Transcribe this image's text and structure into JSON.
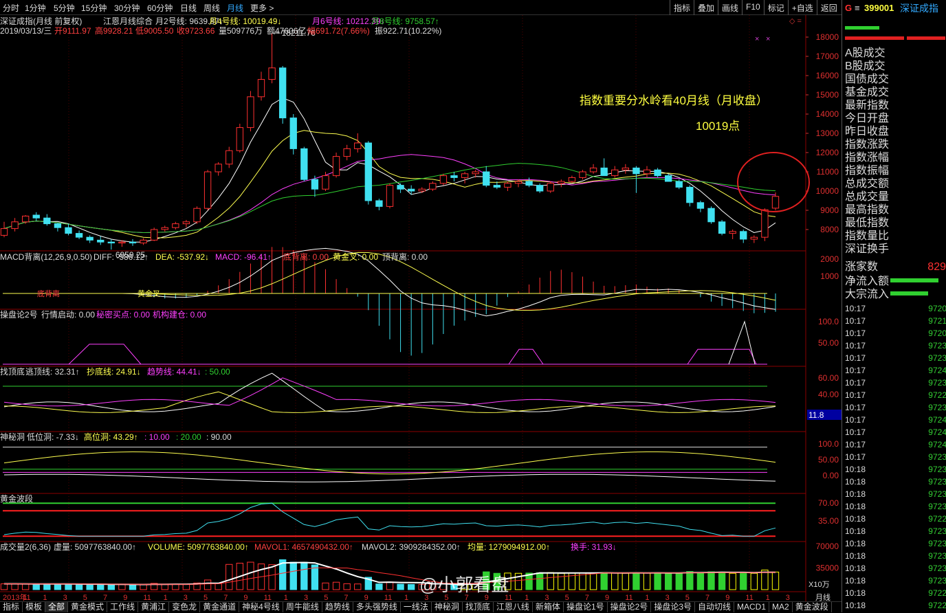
{
  "toolbar": {
    "periods": [
      {
        "label": "分时",
        "active": false
      },
      {
        "label": "1分钟",
        "active": false
      },
      {
        "label": "5分钟",
        "active": false
      },
      {
        "label": "15分钟",
        "active": false
      },
      {
        "label": "30分钟",
        "active": false
      },
      {
        "label": "60分钟",
        "active": false
      },
      {
        "label": "日线",
        "active": false
      },
      {
        "label": "周线",
        "active": false
      },
      {
        "label": "月线",
        "active": true
      },
      {
        "label": "更多 >",
        "active": false
      }
    ],
    "right_buttons": [
      "指标",
      "叠加",
      "画线",
      "F10",
      "标记",
      "+自选",
      "返回"
    ]
  },
  "main_chart": {
    "title": "深证成指(月线 前复权)",
    "indicator_name": "江恩月线综合",
    "ma2": "月2号线: 9639.87↓",
    "ma4": "月4号线: 10019.49↓",
    "ma6": "月6号线: 10212.39↓",
    "ma8": "月8号线: 9758.57↑",
    "date": "2019/03/13/三",
    "open": "开9111.97",
    "high": "高9928.21",
    "low": "低9005.50",
    "close": "收9723.66",
    "volume": "量509776万",
    "amount": "额47606亿",
    "change": "幅691.72(7.66%)",
    "amplitude": "振922.71(10.22%)",
    "high_mark": "18211.76",
    "low_mark": "6959.25",
    "annotation_line1": "指数重要分水岭看40月线（月收盘）",
    "annotation_line2": "10019点",
    "y_ticks": [
      "18000",
      "17000",
      "16000",
      "15000",
      "14000",
      "13000",
      "12000",
      "11000",
      "10000",
      "9000",
      "8000"
    ],
    "colors": {
      "up": "#ff3030",
      "down": "#40e0f0",
      "ma_white": "#ffffff",
      "ma_yellow": "#ffff50",
      "ma_magenta": "#ff40ff",
      "ma_green": "#30d030",
      "annotation": "#ffff40",
      "circle": "#e02020"
    }
  },
  "macd_panel": {
    "title": "MACD背离(12,26,9,0.50)",
    "diff": "DIFF: -586.12↑",
    "dea": "DEA: -537.92↓",
    "macd": "MACD: -96.41↑",
    "dbl": "底背离: 0.00",
    "gold": "黄金叉: 0.00",
    "dbl2": "顶背离: 0.00",
    "y_ticks": [
      "2000",
      "1000"
    ],
    "mark1": "底背离",
    "mark2": "黄金叉"
  },
  "panel3": {
    "title": "操盘论2号",
    "a": "行情启动: 0.00",
    "b": "秘密买点: 0.00",
    "c": "机构建仓: 0.00",
    "y_ticks": [
      "100.0",
      "50.00"
    ]
  },
  "panel4": {
    "title": "找顶底",
    "a": "逃顶线: 32.31↑",
    "b": "抄底线: 24.91↓",
    "c": "趋势线: 44.41↓",
    "d": ": 50.00",
    "y_ticks": [
      "60.00",
      "40.00"
    ],
    "cursor_value": "11.8"
  },
  "panel5": {
    "title": "神秘洞",
    "a": "低位洞: -7.33↓",
    "b": "高位洞: 43.29↑",
    "c": ": 10.00",
    "d": ": 20.00",
    "e": ": 90.00",
    "y_ticks": [
      "100.0",
      "50.00",
      "0.00"
    ]
  },
  "panel6": {
    "title": "黄金波段",
    "y_ticks": [
      "70.00",
      "35.00"
    ]
  },
  "panel7": {
    "title": "成交量2(6,36)",
    "a": "虚量: 5097763840.00↑",
    "b": "VOLUME: 5097763840.00↑",
    "c": "MAVOL1: 4657490432.00↑",
    "d": "MAVOL2: 3909284352.00↑",
    "e": "均量: 1279094912.00↑",
    "f": "换手: 31.93↓",
    "y_ticks": [
      "70000",
      "35000"
    ],
    "unit": "X10万"
  },
  "x_axis": {
    "labels": [
      "2013年",
      "11",
      "1",
      "3",
      "5",
      "7",
      "9",
      "11",
      "1",
      "3",
      "5",
      "7",
      "9",
      "11",
      "1",
      "3",
      "5",
      "7",
      "9",
      "11",
      "1",
      "3",
      "5",
      "7",
      "9",
      "11",
      "1",
      "3",
      "5",
      "7",
      "9",
      "11",
      "1",
      "3",
      "5",
      "7",
      "9",
      "11",
      "1",
      "3"
    ],
    "period": "月线"
  },
  "watermark": "@小郭看盘",
  "right_panel": {
    "code": "399001",
    "name": "深证成指",
    "g_mark": "G",
    "menu_icon": "menu-icon",
    "items": [
      "A股成交",
      "B股成交",
      "国债成交",
      "基金成交",
      "最新指数",
      "今日开盘",
      "昨日收盘",
      "指数涨跌",
      "指数涨幅",
      "指数振幅",
      "总成交额",
      "总成交量",
      "最高指数",
      "最低指数",
      "指数量比",
      "深证换手"
    ],
    "rise_count_label": "涨家数",
    "rise_count_value": "829",
    "net_inflow": "净流入额",
    "big_inflow": "大宗流入",
    "ticks": [
      {
        "t": "10:17",
        "v": "9720"
      },
      {
        "t": "10:17",
        "v": "9721"
      },
      {
        "t": "10:17",
        "v": "9720"
      },
      {
        "t": "10:17",
        "v": "9723"
      },
      {
        "t": "10:17",
        "v": "9723"
      },
      {
        "t": "10:17",
        "v": "9724"
      },
      {
        "t": "10:17",
        "v": "9723"
      },
      {
        "t": "10:17",
        "v": "9722"
      },
      {
        "t": "10:17",
        "v": "9723"
      },
      {
        "t": "10:17",
        "v": "9724"
      },
      {
        "t": "10:17",
        "v": "9724"
      },
      {
        "t": "10:17",
        "v": "9724"
      },
      {
        "t": "10:17",
        "v": "9723"
      },
      {
        "t": "10:18",
        "v": "9723"
      },
      {
        "t": "10:18",
        "v": "9723"
      },
      {
        "t": "10:18",
        "v": "9723"
      },
      {
        "t": "10:18",
        "v": "9723"
      },
      {
        "t": "10:18",
        "v": "9722"
      },
      {
        "t": "10:18",
        "v": "9723"
      },
      {
        "t": "10:18",
        "v": "9723"
      },
      {
        "t": "10:18",
        "v": "9723"
      },
      {
        "t": "10:18",
        "v": "9723"
      },
      {
        "t": "10:18",
        "v": "9723"
      },
      {
        "t": "10:18",
        "v": "9722"
      },
      {
        "t": "10:18",
        "v": "9722"
      }
    ]
  },
  "bottom_tabs": [
    "指标",
    "模板",
    "全部",
    "黄金模式",
    "工作线",
    "黄浦江",
    "变色龙",
    "黄金通道",
    "神秘4号线",
    "周牛能线",
    "趋势线",
    "多头强势线",
    "一线法",
    "神秘洞",
    "找顶底",
    "江恩八线",
    "新箱体",
    "操盘论1号",
    "操盘论2号",
    "操盘论3号",
    "自动切线",
    "MACD1",
    "MA2",
    "黄金波段"
  ],
  "bottom_active": "全部",
  "chart_data": {
    "type": "candlestick",
    "title": "深证成指(月线 前复权)",
    "candles": [
      {
        "o": 7700,
        "h": 8400,
        "l": 7600,
        "c": 8050
      },
      {
        "o": 8050,
        "h": 8600,
        "l": 7900,
        "c": 8400
      },
      {
        "o": 8400,
        "h": 8750,
        "l": 8300,
        "c": 8700
      },
      {
        "o": 8750,
        "h": 8900,
        "l": 8450,
        "c": 8600
      },
      {
        "o": 8600,
        "h": 8800,
        "l": 8200,
        "c": 8300
      },
      {
        "o": 8300,
        "h": 8350,
        "l": 7900,
        "c": 8100
      },
      {
        "o": 8100,
        "h": 8300,
        "l": 7700,
        "c": 7800
      },
      {
        "o": 7800,
        "h": 7950,
        "l": 7500,
        "c": 7600
      },
      {
        "o": 7600,
        "h": 7700,
        "l": 7300,
        "c": 7450
      },
      {
        "o": 7450,
        "h": 7650,
        "l": 7200,
        "c": 7350
      },
      {
        "o": 7350,
        "h": 7500,
        "l": 6959,
        "c": 7300
      },
      {
        "o": 7300,
        "h": 7450,
        "l": 7100,
        "c": 7350
      },
      {
        "o": 7350,
        "h": 7500,
        "l": 7150,
        "c": 7300
      },
      {
        "o": 7300,
        "h": 7550,
        "l": 7200,
        "c": 7450
      },
      {
        "o": 7450,
        "h": 8100,
        "l": 7400,
        "c": 8000
      },
      {
        "o": 8000,
        "h": 8200,
        "l": 7900,
        "c": 8100
      },
      {
        "o": 8100,
        "h": 8400,
        "l": 8000,
        "c": 8300
      },
      {
        "o": 8300,
        "h": 8500,
        "l": 8100,
        "c": 8400
      },
      {
        "o": 8400,
        "h": 9200,
        "l": 8300,
        "c": 9100
      },
      {
        "o": 9100,
        "h": 11100,
        "l": 9000,
        "c": 11000
      },
      {
        "o": 11000,
        "h": 11500,
        "l": 10800,
        "c": 11400
      },
      {
        "o": 11400,
        "h": 12300,
        "l": 11200,
        "c": 12100
      },
      {
        "o": 12100,
        "h": 13500,
        "l": 12000,
        "c": 13300
      },
      {
        "o": 13300,
        "h": 15200,
        "l": 13100,
        "c": 14900
      },
      {
        "o": 14900,
        "h": 16200,
        "l": 14700,
        "c": 15800
      },
      {
        "o": 15800,
        "h": 18211,
        "l": 15600,
        "c": 16400
      },
      {
        "o": 16400,
        "h": 16500,
        "l": 13500,
        "c": 13800
      },
      {
        "o": 13800,
        "h": 14000,
        "l": 11900,
        "c": 12200
      },
      {
        "o": 12200,
        "h": 12300,
        "l": 10500,
        "c": 10600
      },
      {
        "o": 10600,
        "h": 10800,
        "l": 9700,
        "c": 10100
      },
      {
        "o": 10100,
        "h": 11000,
        "l": 10000,
        "c": 10800
      },
      {
        "o": 10800,
        "h": 12000,
        "l": 10700,
        "c": 11800
      },
      {
        "o": 11800,
        "h": 12400,
        "l": 11600,
        "c": 12200
      },
      {
        "o": 12200,
        "h": 13000,
        "l": 12000,
        "c": 12500
      },
      {
        "o": 12500,
        "h": 12600,
        "l": 9300,
        "c": 9500
      },
      {
        "o": 9500,
        "h": 9600,
        "l": 9000,
        "c": 9200
      },
      {
        "o": 9200,
        "h": 10400,
        "l": 9100,
        "c": 10300
      },
      {
        "o": 10300,
        "h": 10400,
        "l": 9900,
        "c": 10100
      },
      {
        "o": 10100,
        "h": 10300,
        "l": 9800,
        "c": 10000
      },
      {
        "o": 10000,
        "h": 10200,
        "l": 9900,
        "c": 10100
      },
      {
        "o": 10100,
        "h": 10500,
        "l": 10000,
        "c": 10400
      },
      {
        "o": 10400,
        "h": 10900,
        "l": 10300,
        "c": 10800
      },
      {
        "o": 10800,
        "h": 11000,
        "l": 10500,
        "c": 10700
      },
      {
        "o": 10700,
        "h": 11000,
        "l": 10400,
        "c": 10900
      },
      {
        "o": 10900,
        "h": 11100,
        "l": 10700,
        "c": 11000
      },
      {
        "o": 11000,
        "h": 11300,
        "l": 10200,
        "c": 10300
      },
      {
        "o": 10300,
        "h": 10500,
        "l": 10100,
        "c": 10200
      },
      {
        "o": 10200,
        "h": 10500,
        "l": 10000,
        "c": 10400
      },
      {
        "o": 10400,
        "h": 10600,
        "l": 10200,
        "c": 10500
      },
      {
        "o": 10500,
        "h": 10700,
        "l": 10200,
        "c": 10300
      },
      {
        "o": 10300,
        "h": 10400,
        "l": 9900,
        "c": 10000
      },
      {
        "o": 10000,
        "h": 10500,
        "l": 9900,
        "c": 10400
      },
      {
        "o": 10400,
        "h": 10600,
        "l": 10200,
        "c": 10500
      },
      {
        "o": 10500,
        "h": 10800,
        "l": 10400,
        "c": 10700
      },
      {
        "o": 10700,
        "h": 11100,
        "l": 10600,
        "c": 11000
      },
      {
        "o": 11000,
        "h": 11400,
        "l": 10900,
        "c": 11200
      },
      {
        "o": 11200,
        "h": 11700,
        "l": 11000,
        "c": 10800
      },
      {
        "o": 10800,
        "h": 11300,
        "l": 10700,
        "c": 11100
      },
      {
        "o": 11100,
        "h": 11400,
        "l": 10900,
        "c": 11200
      },
      {
        "o": 11200,
        "h": 11300,
        "l": 9900,
        "c": 10900
      },
      {
        "o": 10900,
        "h": 11300,
        "l": 10700,
        "c": 11100
      },
      {
        "o": 11100,
        "h": 11200,
        "l": 10700,
        "c": 10800
      },
      {
        "o": 10800,
        "h": 10900,
        "l": 10500,
        "c": 10500
      },
      {
        "o": 10500,
        "h": 10600,
        "l": 10100,
        "c": 10200
      },
      {
        "o": 10200,
        "h": 10300,
        "l": 9200,
        "c": 9400
      },
      {
        "o": 9400,
        "h": 9500,
        "l": 8900,
        "c": 9100
      },
      {
        "o": 9100,
        "h": 9200,
        "l": 8300,
        "c": 8400
      },
      {
        "o": 8400,
        "h": 8500,
        "l": 7700,
        "c": 7800
      },
      {
        "o": 7800,
        "h": 8000,
        "l": 7500,
        "c": 7900
      },
      {
        "o": 7900,
        "h": 8000,
        "l": 7300,
        "c": 7500
      },
      {
        "o": 7500,
        "h": 7700,
        "l": 7300,
        "c": 7600
      },
      {
        "o": 7600,
        "h": 9100,
        "l": 7400,
        "c": 9030
      },
      {
        "o": 9111,
        "h": 9928,
        "l": 9005,
        "c": 9723
      }
    ],
    "ylim": [
      7000,
      18500
    ]
  }
}
